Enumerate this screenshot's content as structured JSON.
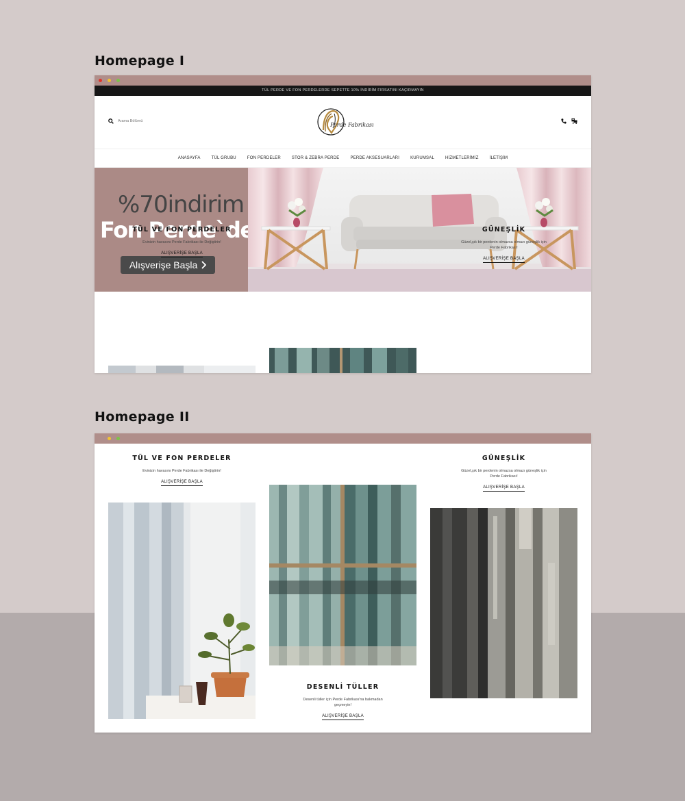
{
  "colors": {
    "background": "#d4cbca",
    "background_bottom": "#b3abab",
    "titlebar": "#b08e8a",
    "hero_panel": "#ab8a86",
    "announcement_bar": "#161616"
  },
  "sections": {
    "homepage1_label": "Homepage I",
    "homepage2_label": "Homepage II"
  },
  "announcement": "TÜL PERDE VE FON PERDELERDE SEPETTE 10% İNDİRİM FIRSATINI KAÇIRMAYIN",
  "search": {
    "placeholder": "Arama Bölümü"
  },
  "logo": {
    "text": "Perde Fabrikası"
  },
  "header_icons": [
    "phone-icon",
    "cart-icon"
  ],
  "nav": [
    "ANASAYFA",
    "TÜL GRUBU",
    "FON PERDELER",
    "STOR & ZEBRA PERDE",
    "PERDE AKSESUARLARI",
    "KURUMSAL",
    "HİZMETLERİMİZ",
    "İLETİŞİM"
  ],
  "hero": {
    "line1_a": "%70",
    "line1_b": "indirim",
    "line2": "Fon Perde`de",
    "button": "Alışverişe Başla",
    "button_icon": "chevron-right-icon"
  },
  "categories": {
    "tul": {
      "title": "TÜL VE FON PERDELER",
      "desc": "Evinizin havasını Perde Fabrikası ile Değiştirin!",
      "link": "ALIŞVERİŞE BAŞLA"
    },
    "gunes": {
      "title": "GÜNEŞLİK",
      "desc_line1": "Güzel,şık bir perdenin olmazsa olmazı güneşlik için",
      "desc_line2": "Perde Fabrikası!",
      "link": "ALIŞVERİŞE BAŞLA"
    },
    "desenli": {
      "title": "DESENLİ TÜLLER",
      "desc_line1": "Desenli tüller için Perde Fabrikası'na bakmadan",
      "desc_line2": "geçmeyin!",
      "link": "ALIŞVERİŞE BAŞLA"
    }
  }
}
